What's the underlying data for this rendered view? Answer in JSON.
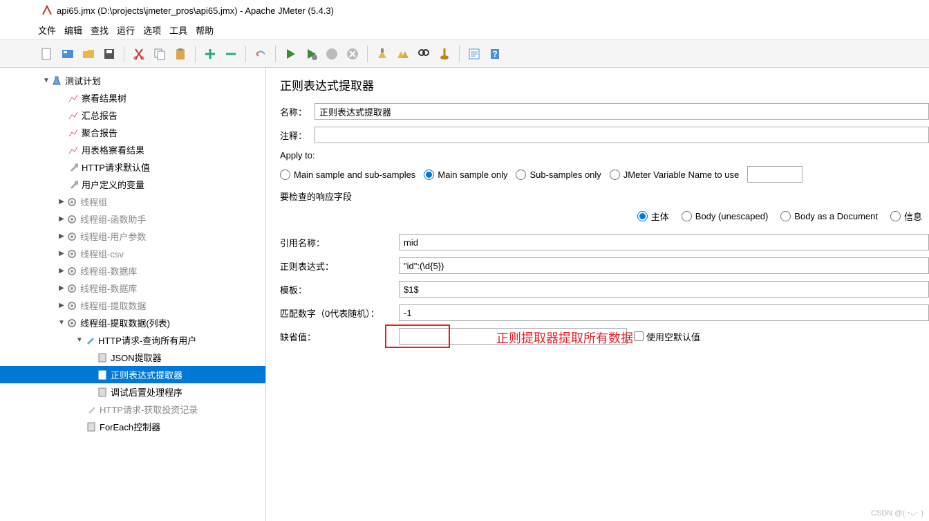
{
  "titlebar": {
    "text": "api65.jmx (D:\\projects\\jmeter_pros\\api65.jmx) - Apache JMeter (5.4.3)"
  },
  "menu": {
    "file": "文件",
    "edit": "编辑",
    "search": "查找",
    "run": "运行",
    "options": "选项",
    "tools": "工具",
    "help": "帮助"
  },
  "tree": {
    "root": "测试计划",
    "n1": "察看结果树",
    "n2": "汇总报告",
    "n3": "聚合报告",
    "n4": "用表格察看结果",
    "n5": "HTTP请求默认值",
    "n6": "用户定义的变量",
    "n7": "线程组",
    "n8": "线程组-函数助手",
    "n9": "线程组-用户参数",
    "n10": "线程组-csv",
    "n11": "线程组-数据库",
    "n12": "线程组-数据库",
    "n13": "线程组-提取数据",
    "n14": "线程组-提取数据(列表)",
    "n15": "HTTP请求-查询所有用户",
    "n16": "JSON提取器",
    "n17": "正则表达式提取器",
    "n18": "调试后置处理程序",
    "n19": "HTTP请求-获取投资记录",
    "n20": "ForEach控制器"
  },
  "panel": {
    "title": "正则表达式提取器",
    "name_label": "名称：",
    "name_value": "正则表达式提取器",
    "comment_label": "注释：",
    "comment_value": "",
    "apply_to_label": "Apply to:",
    "apply_opt1": "Main sample and sub-samples",
    "apply_opt2": "Main sample only",
    "apply_opt3": "Sub-samples only",
    "apply_opt4": "JMeter Variable Name to use",
    "field_to_check": "要检查的响应字段",
    "resp_opt1": "主体",
    "resp_opt2": "Body (unescaped)",
    "resp_opt3": "Body as a Document",
    "resp_opt4": "信息",
    "ref_name_label": "引用名称：",
    "ref_name_value": "mid",
    "regex_label": "正则表达式：",
    "regex_value": "\"id\":(\\d{5})",
    "template_label": "模板：",
    "template_value": "$1$",
    "match_label": "匹配数字（0代表随机）：",
    "match_value": "-1",
    "default_label": "缺省值：",
    "default_value": "",
    "use_empty_label": "使用空默认值"
  },
  "annotation": {
    "text": "正则提取器提取所有数据"
  },
  "watermark": "CSDN @( ･ᴗ･ )"
}
